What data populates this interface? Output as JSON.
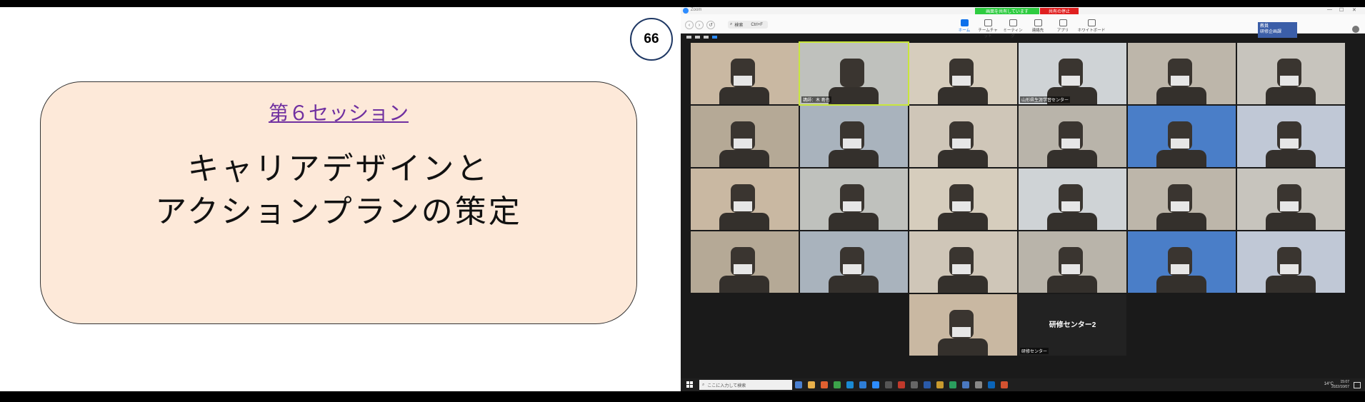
{
  "slide": {
    "page_number": "66",
    "session_title": "第６セッション",
    "main_title": "キャリアデザインと\nアクションプランの策定",
    "colors": {
      "box_fill": "#fde9d9",
      "session_title": "#7030a0",
      "badge_border": "#1f3864"
    }
  },
  "zoom": {
    "app_name": "Zoom",
    "share_status": "画面を共有しています",
    "stop_share_label": "共有の停止",
    "search_placeholder": "検索",
    "search_shortcut": "Ctrl+F",
    "tabs": [
      {
        "label": "ホーム",
        "icon": "home-icon",
        "active": true
      },
      {
        "label": "チームチャット",
        "icon": "chat-icon",
        "active": false
      },
      {
        "label": "ミーティング",
        "icon": "clock-icon",
        "active": false
      },
      {
        "label": "連絡先",
        "icon": "contacts-icon",
        "active": false
      },
      {
        "label": "アプリ",
        "icon": "apps-icon",
        "active": false
      },
      {
        "label": "ホワイトボード",
        "icon": "whiteboard-icon",
        "active": false
      }
    ],
    "name_tag": {
      "line1": "教員",
      "line2": "研修企画課"
    },
    "participants": [
      {
        "label": ""
      },
      {
        "label": "講師：木 島也",
        "speaker": true
      },
      {
        "label": ""
      },
      {
        "label": "山形県生涯学習センター"
      },
      {
        "label": ""
      },
      {
        "label": ""
      },
      {
        "label": ""
      },
      {
        "label": ""
      },
      {
        "label": ""
      },
      {
        "label": ""
      },
      {
        "label": ""
      },
      {
        "label": ""
      },
      {
        "label": ""
      },
      {
        "label": ""
      },
      {
        "label": ""
      },
      {
        "label": ""
      },
      {
        "label": ""
      },
      {
        "label": ""
      },
      {
        "label": ""
      },
      {
        "label": ""
      },
      {
        "label": ""
      },
      {
        "label": ""
      },
      {
        "label": ""
      },
      {
        "label": ""
      },
      {
        "label": ""
      },
      {
        "label": "研修センター",
        "center_name": "研修センター2",
        "camera_off": true
      }
    ]
  },
  "taskbar": {
    "search_placeholder": "ここに入力して検索",
    "temperature": "14°C",
    "time": "15:07",
    "date": "2022/10/07"
  }
}
